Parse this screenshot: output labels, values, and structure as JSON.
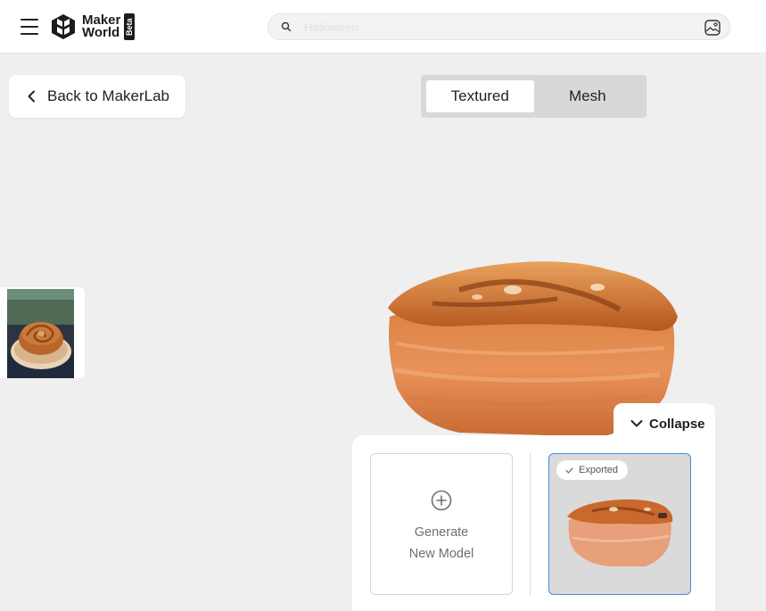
{
  "header": {
    "logo_line1": "Maker",
    "logo_line2": "World",
    "logo_badge": "Beta",
    "search_placeholder": "Halloween",
    "search_value": ""
  },
  "back_button": {
    "label": "Back to MakerLab"
  },
  "view_toggle": {
    "options": [
      "Textured",
      "Mesh"
    ],
    "active": "Textured"
  },
  "collapse": {
    "label": "Collapse"
  },
  "panel": {
    "generate_line1": "Generate",
    "generate_line2": "New Model",
    "exported_badge": "Exported"
  },
  "colors": {
    "accent_border": "#3d8fe0",
    "background": "#efefef",
    "toggle_track": "#d8d8d8"
  },
  "icons": [
    "hamburger-icon",
    "search-icon",
    "image-search-icon",
    "chevron-left-icon",
    "chevron-down-icon",
    "plus-circle-icon",
    "check-icon"
  ]
}
